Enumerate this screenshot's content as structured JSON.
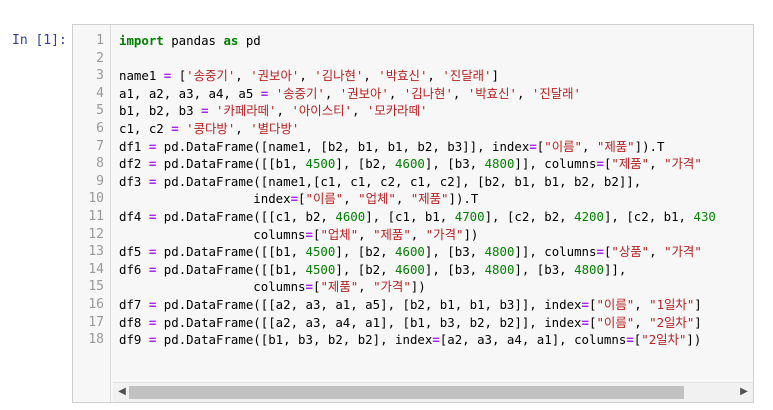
{
  "cell": {
    "prompt": "In [1]:",
    "line_numbers": [
      "1",
      "2",
      "3",
      "4",
      "5",
      "6",
      "7",
      "8",
      "9",
      "10",
      "11",
      "12",
      "13",
      "14",
      "15",
      "16",
      "17",
      "18"
    ],
    "lines": [
      [
        [
          "kw",
          "import"
        ],
        [
          "plain",
          " pandas "
        ],
        [
          "kw",
          "as"
        ],
        [
          "plain",
          " pd"
        ]
      ],
      [],
      [
        [
          "plain",
          "name1 "
        ],
        [
          "op",
          "="
        ],
        [
          "plain",
          " ["
        ],
        [
          "str",
          "'송중기'"
        ],
        [
          "plain",
          ", "
        ],
        [
          "str",
          "'권보아'"
        ],
        [
          "plain",
          ", "
        ],
        [
          "str",
          "'김나현'"
        ],
        [
          "plain",
          ", "
        ],
        [
          "str",
          "'박효신'"
        ],
        [
          "plain",
          ", "
        ],
        [
          "str",
          "'진달래'"
        ],
        [
          "plain",
          "]"
        ]
      ],
      [
        [
          "plain",
          "a1, a2, a3, a4, a5 "
        ],
        [
          "op",
          "="
        ],
        [
          "plain",
          " "
        ],
        [
          "str",
          "'송중기'"
        ],
        [
          "plain",
          ", "
        ],
        [
          "str",
          "'권보아'"
        ],
        [
          "plain",
          ", "
        ],
        [
          "str",
          "'김나현'"
        ],
        [
          "plain",
          ", "
        ],
        [
          "str",
          "'박효신'"
        ],
        [
          "plain",
          ", "
        ],
        [
          "str",
          "'진달래'"
        ]
      ],
      [
        [
          "plain",
          "b1, b2, b3 "
        ],
        [
          "op",
          "="
        ],
        [
          "plain",
          " "
        ],
        [
          "str",
          "'카페라떼'"
        ],
        [
          "plain",
          ", "
        ],
        [
          "str",
          "'아이스티'"
        ],
        [
          "plain",
          ", "
        ],
        [
          "str",
          "'모카라떼'"
        ]
      ],
      [
        [
          "plain",
          "c1, c2 "
        ],
        [
          "op",
          "="
        ],
        [
          "plain",
          " "
        ],
        [
          "str",
          "'콩다방'"
        ],
        [
          "plain",
          ", "
        ],
        [
          "str",
          "'별다방'"
        ]
      ],
      [
        [
          "plain",
          "df1 "
        ],
        [
          "op",
          "="
        ],
        [
          "plain",
          " pd.DataFrame([name1, [b2, b1, b1, b2, b3]], index"
        ],
        [
          "op",
          "="
        ],
        [
          "plain",
          "["
        ],
        [
          "str",
          "\"이름\""
        ],
        [
          "plain",
          ", "
        ],
        [
          "str",
          "\"제품\""
        ],
        [
          "plain",
          "]).T"
        ]
      ],
      [
        [
          "plain",
          "df2 "
        ],
        [
          "op",
          "="
        ],
        [
          "plain",
          " pd.DataFrame([[b1, "
        ],
        [
          "num",
          "4500"
        ],
        [
          "plain",
          "], [b2, "
        ],
        [
          "num",
          "4600"
        ],
        [
          "plain",
          "], [b3, "
        ],
        [
          "num",
          "4800"
        ],
        [
          "plain",
          "]], columns"
        ],
        [
          "op",
          "="
        ],
        [
          "plain",
          "["
        ],
        [
          "str",
          "\"제품\""
        ],
        [
          "plain",
          ", "
        ],
        [
          "str",
          "\"가격\""
        ]
      ],
      [
        [
          "plain",
          "df3 "
        ],
        [
          "op",
          "="
        ],
        [
          "plain",
          " pd.DataFrame([name1,[c1, c1, c2, c1, c2], [b2, b1, b1, b2, b2]],"
        ]
      ],
      [
        [
          "plain",
          "                  index"
        ],
        [
          "op",
          "="
        ],
        [
          "plain",
          "["
        ],
        [
          "str",
          "\"이름\""
        ],
        [
          "plain",
          ", "
        ],
        [
          "str",
          "\"업체\""
        ],
        [
          "plain",
          ", "
        ],
        [
          "str",
          "\"제품\""
        ],
        [
          "plain",
          "]).T"
        ]
      ],
      [
        [
          "plain",
          "df4 "
        ],
        [
          "op",
          "="
        ],
        [
          "plain",
          " pd.DataFrame([[c1, b2, "
        ],
        [
          "num",
          "4600"
        ],
        [
          "plain",
          "], [c1, b1, "
        ],
        [
          "num",
          "4700"
        ],
        [
          "plain",
          "], [c2, b2, "
        ],
        [
          "num",
          "4200"
        ],
        [
          "plain",
          "], [c2, b1, "
        ],
        [
          "num",
          "430"
        ]
      ],
      [
        [
          "plain",
          "                  columns"
        ],
        [
          "op",
          "="
        ],
        [
          "plain",
          "["
        ],
        [
          "str",
          "\"업체\""
        ],
        [
          "plain",
          ", "
        ],
        [
          "str",
          "\"제품\""
        ],
        [
          "plain",
          ", "
        ],
        [
          "str",
          "\"가격\""
        ],
        [
          "plain",
          "])"
        ]
      ],
      [
        [
          "plain",
          "df5 "
        ],
        [
          "op",
          "="
        ],
        [
          "plain",
          " pd.DataFrame([[b1, "
        ],
        [
          "num",
          "4500"
        ],
        [
          "plain",
          "], [b2, "
        ],
        [
          "num",
          "4600"
        ],
        [
          "plain",
          "], [b3, "
        ],
        [
          "num",
          "4800"
        ],
        [
          "plain",
          "]], columns"
        ],
        [
          "op",
          "="
        ],
        [
          "plain",
          "["
        ],
        [
          "str",
          "\"상품\""
        ],
        [
          "plain",
          ", "
        ],
        [
          "str",
          "\"가격\""
        ]
      ],
      [
        [
          "plain",
          "df6 "
        ],
        [
          "op",
          "="
        ],
        [
          "plain",
          " pd.DataFrame([[b1, "
        ],
        [
          "num",
          "4500"
        ],
        [
          "plain",
          "], [b2, "
        ],
        [
          "num",
          "4600"
        ],
        [
          "plain",
          "], [b3, "
        ],
        [
          "num",
          "4800"
        ],
        [
          "plain",
          "], [b3, "
        ],
        [
          "num",
          "4800"
        ],
        [
          "plain",
          "]],"
        ]
      ],
      [
        [
          "plain",
          "                  columns"
        ],
        [
          "op",
          "="
        ],
        [
          "plain",
          "["
        ],
        [
          "str",
          "\"제품\""
        ],
        [
          "plain",
          ", "
        ],
        [
          "str",
          "\"가격\""
        ],
        [
          "plain",
          "])"
        ]
      ],
      [
        [
          "plain",
          "df7 "
        ],
        [
          "op",
          "="
        ],
        [
          "plain",
          " pd.DataFrame([[a2, a3, a1, a5], [b2, b1, b1, b3]], index"
        ],
        [
          "op",
          "="
        ],
        [
          "plain",
          "["
        ],
        [
          "str",
          "\"이름\""
        ],
        [
          "plain",
          ", "
        ],
        [
          "str",
          "\"1일차\""
        ],
        [
          "plain",
          "]"
        ]
      ],
      [
        [
          "plain",
          "df8 "
        ],
        [
          "op",
          "="
        ],
        [
          "plain",
          " pd.DataFrame([[a2, a3, a4, a1], [b1, b3, b2, b2]], index"
        ],
        [
          "op",
          "="
        ],
        [
          "plain",
          "["
        ],
        [
          "str",
          "\"이름\""
        ],
        [
          "plain",
          ", "
        ],
        [
          "str",
          "\"2일차\""
        ],
        [
          "plain",
          "]"
        ]
      ],
      [
        [
          "plain",
          "df9 "
        ],
        [
          "op",
          "="
        ],
        [
          "plain",
          " pd.DataFrame([b1, b3, b2, b2], index"
        ],
        [
          "op",
          "="
        ],
        [
          "plain",
          "[a2, a3, a4, a1], columns"
        ],
        [
          "op",
          "="
        ],
        [
          "plain",
          "["
        ],
        [
          "str",
          "\"2일차\""
        ],
        [
          "plain",
          "])"
        ]
      ]
    ]
  },
  "scrollbar": {
    "left_arrow": "◀",
    "right_arrow": "▶"
  },
  "colors": {
    "keyword": "#008000",
    "string": "#ba2121",
    "number": "#008000",
    "operator": "#aa22ff",
    "prompt": "#303f9f"
  }
}
